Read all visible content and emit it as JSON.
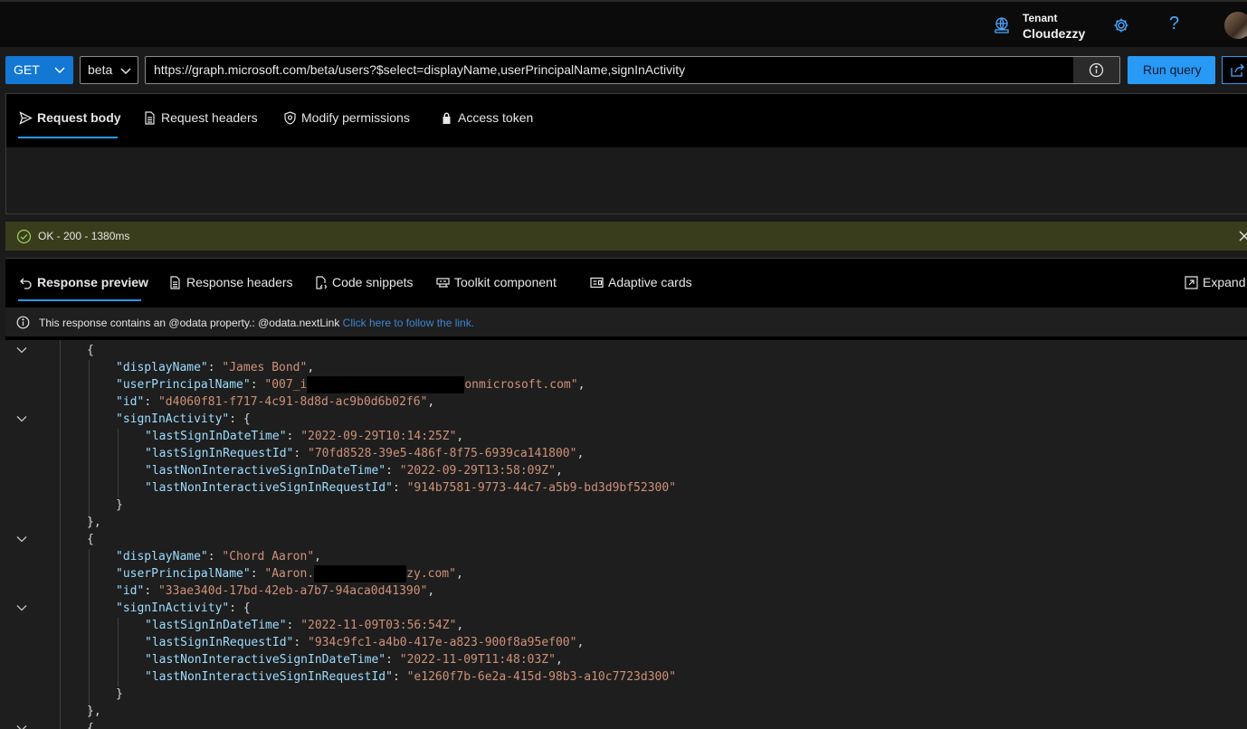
{
  "header": {
    "tenant_label": "Tenant",
    "tenant_name": "Cloudezzy",
    "help_glyph": "?",
    "icons": [
      "tenant-globe-icon",
      "gear-icon",
      "help-icon",
      "avatar"
    ]
  },
  "query": {
    "method": "GET",
    "version": "beta",
    "url": "https://graph.microsoft.com/beta/users?$select=displayName,userPrincipalName,signInActivity",
    "run_label": "Run query"
  },
  "request_tabs": [
    {
      "label": "Request body",
      "icon": "send-icon",
      "active": true
    },
    {
      "label": "Request headers",
      "icon": "document-icon"
    },
    {
      "label": "Modify permissions",
      "icon": "shield-icon"
    },
    {
      "label": "Access token",
      "icon": "lock-icon"
    }
  ],
  "status": {
    "text": "OK - 200 - 1380ms",
    "color": "#393d1b"
  },
  "response_tabs": [
    {
      "label": "Response preview",
      "icon": "back-arrow-icon",
      "active": true
    },
    {
      "label": "Response headers",
      "icon": "document-icon"
    },
    {
      "label": "Code snippets",
      "icon": "code-icon"
    },
    {
      "label": "Toolkit component",
      "icon": "toolkit-icon"
    },
    {
      "label": "Adaptive cards",
      "icon": "card-icon"
    },
    {
      "label": "Expand",
      "icon": "expand-icon"
    }
  ],
  "notice": {
    "text": "This response contains an @odata property.: @odata.nextLink ",
    "link": "Click here to follow the link."
  },
  "json": {
    "users": [
      {
        "displayName": "James Bond",
        "upn_prefix": "007_i",
        "upn_suffix": "onmicrosoft.com",
        "id": "d4060f81-f717-4c91-8d8d-ac9b0d6b02f6",
        "lastSignInDateTime": "2022-09-29T10:14:25Z",
        "lastSignInRequestId": "70fd8528-39e5-486f-8f75-6939ca141800",
        "lastNonInteractiveSignInDateTime": "2022-09-29T13:58:09Z",
        "lastNonInteractiveSignInRequestId": "914b7581-9773-44c7-a5b9-bd3d9bf52300"
      },
      {
        "displayName": "Chord Aaron",
        "upn_prefix": "Aaron.",
        "upn_suffix": "zy.com",
        "id": "33ae340d-17bd-42eb-a7b7-94aca0d41390",
        "lastSignInDateTime": "2022-11-09T03:56:54Z",
        "lastSignInRequestId": "934c9fc1-a4b0-417e-a823-900f8a95ef00",
        "lastNonInteractiveSignInDateTime": "2022-11-09T11:48:03Z",
        "lastNonInteractiveSignInRequestId": "e1260f7b-6e2a-415d-98b3-a10c7723d300"
      }
    ],
    "colors": {
      "key": "#9cdcfe",
      "string": "#ce9178",
      "punct": "#d4d4d4"
    }
  }
}
